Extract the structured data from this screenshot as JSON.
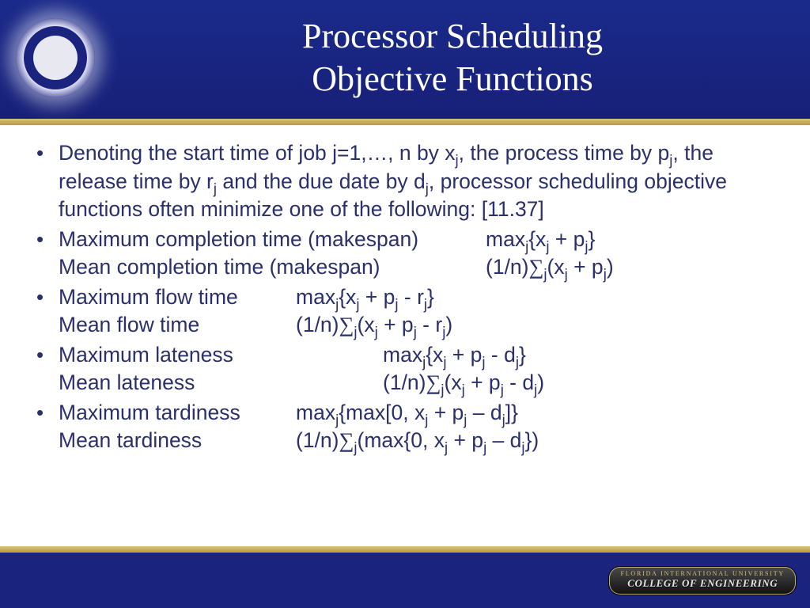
{
  "title_line1": "Processor Scheduling",
  "title_line2": "Objective Functions",
  "bullets": {
    "intro": {
      "pre": "Denoting the start time of job j=1,…, n by x",
      "s1": "j",
      "mid1": ", the process time by p",
      "s2": "j",
      "mid2": ", the release time by r",
      "s3": "j",
      "mid3": " and the due date by d",
      "s4": "j",
      "post": ", processor scheduling objective functions often minimize one of the following: [11.37]"
    },
    "makespan": {
      "max_label": "Maximum completion time (makespan)",
      "max_expr_pre": "max",
      "max_expr_sub": "j",
      "max_expr_body": "{x",
      "max_expr_s1": "j",
      "max_expr_mid": " + p",
      "max_expr_s2": "j",
      "max_expr_end": "}",
      "mean_label": "Mean completion time (makespan)",
      "mean_expr_pre": "(1/n)",
      "mean_sigma": "∑",
      "mean_sub": "j",
      "mean_body": "(x",
      "mean_s1": "j",
      "mean_mid": " + p",
      "mean_s2": "j",
      "mean_end": ")"
    },
    "flow": {
      "max_label": "Maximum flow time",
      "max_pre": "max",
      "max_sub": "j",
      "max_body": "{x",
      "max_s1": "j",
      "max_m1": " + p",
      "max_s2": "j",
      "max_m2": " - r",
      "max_s3": "j",
      "max_end": "}",
      "mean_label": "Mean flow time",
      "mean_pre": "(1/n)",
      "mean_sigma": "∑",
      "mean_sub": "j",
      "mean_body": "(x",
      "mean_s1": "j",
      "mean_m1": " + p",
      "mean_s2": "j",
      "mean_m2": " - r",
      "mean_s3": "j",
      "mean_end": ")"
    },
    "lateness": {
      "max_label": "Maximum lateness",
      "max_pre": "max",
      "max_sub": "j",
      "max_body": "{x",
      "max_s1": "j",
      "max_m1": " + p",
      "max_s2": "j",
      "max_m2": " - d",
      "max_s3": "j",
      "max_end": "}",
      "mean_label": "Mean lateness",
      "mean_pre": "(1/n)",
      "mean_sigma": "∑",
      "mean_sub": "j",
      "mean_body": "(x",
      "mean_s1": "j",
      "mean_m1": " + p",
      "mean_s2": "j",
      "mean_m2": " - d",
      "mean_s3": "j",
      "mean_end": ")"
    },
    "tardiness": {
      "max_label": "Maximum tardiness",
      "max_pre": "max",
      "max_sub": "j",
      "max_body": "{max[0, x",
      "max_s1": "j",
      "max_m1": " + p",
      "max_s2": "j",
      "max_m2": " – d",
      "max_s3": "j",
      "max_end": "]}",
      "mean_label": "Mean tardiness",
      "mean_pre": "(1/n)",
      "mean_sigma": "∑",
      "mean_sub": "j",
      "mean_body": "(max{0, x",
      "mean_s1": "j",
      "mean_m1": " + p",
      "mean_s2": "j",
      "mean_m2": " – d",
      "mean_s3": "j",
      "mean_end": "})"
    }
  },
  "footer": {
    "line1": "FLORIDA INTERNATIONAL UNIVERSITY",
    "line2": "COLLEGE OF ENGINEERING"
  }
}
